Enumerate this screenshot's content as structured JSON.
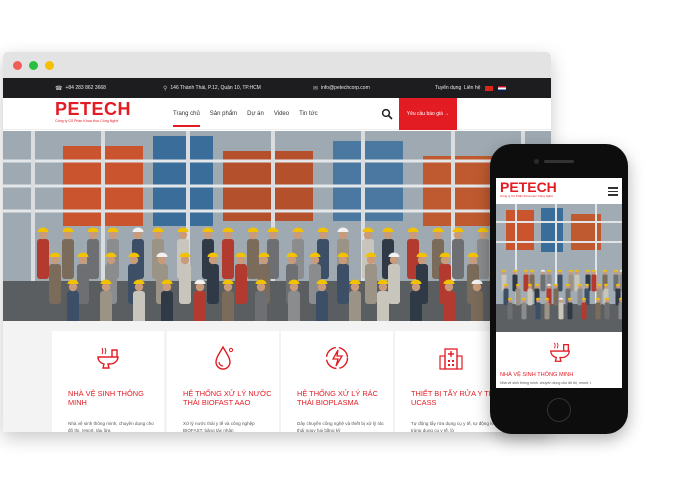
{
  "colors": {
    "brand_red": "#e31b23",
    "topbar_bg": "#1d1d1f",
    "dot_red": "#ee5f57",
    "dot_green": "#29c041",
    "dot_yellow": "#f5c000"
  },
  "topbar": {
    "phone": "+84 283 862 3668",
    "address": "146 Thành Thái, P.12, Quận 10, TP.HCM",
    "email": "info@petechcorp.com",
    "recruit": "Tuyển dụng",
    "contact": "Liên hệ",
    "phone_icon": "phone-icon",
    "address_icon": "map-pin-icon",
    "email_icon": "mail-icon"
  },
  "brand": {
    "name": "PETECH",
    "tagline": "Công ty Cổ Phần Khoa Học Công Nghệ"
  },
  "nav": {
    "items": [
      "Trang chủ",
      "Sản phẩm",
      "Dự án",
      "Video",
      "Tin tức"
    ],
    "active": "Trang chủ",
    "cta": "Yêu cầu báo giá →",
    "search_icon": "search-icon"
  },
  "hero": {
    "slide_count": 3,
    "active_slide": 1
  },
  "cards": [
    {
      "icon": "toilet-icon",
      "title": "NHÀ VỆ SINH THÔNG MINH",
      "text": "Nhà vệ sinh thông minh, chuyên dụng cho đô thị, resort, tàu lửa"
    },
    {
      "icon": "water-drop-icon",
      "title": "HỆ THỐNG XỬ LÝ NƯỚC THẢI BIOFAST AAO",
      "text": "Xử lý nước thải y tế và công nghệp BIOFAST, bảng tác nhân"
    },
    {
      "icon": "plasma-icon",
      "title": "HỆ THỐNG XỬ LÝ RÁC THẢI BIOPLASMA",
      "text": "Dây chuyền công nghệ và thiết bị xử lý rác thải nguy hại bằng kỹ"
    },
    {
      "icon": "hospital-icon",
      "title": "THIẾT BỊ TẨY RỬA Y TẾ UCASS",
      "text": "Tự động tẩy rửa dụng cụ y tế, tự động khử trùng dụng cụ y tế, lò"
    }
  ],
  "mobile": {
    "menu_icon": "hamburger-menu-icon",
    "card_title": "NHÀ VỆ SINH THÔNG MINH",
    "card_text": "Nhà vệ sinh thông minh, chuyên dụng cho đô thị, resort, t"
  }
}
